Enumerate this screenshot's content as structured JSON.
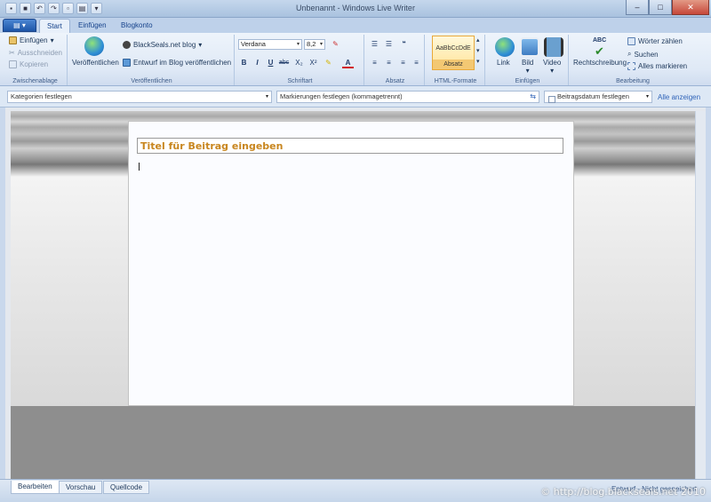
{
  "window": {
    "title": "Unbenannt - Windows Live Writer"
  },
  "tabs": [
    {
      "label": "Start"
    },
    {
      "label": "Einfügen"
    },
    {
      "label": "Blogkonto"
    }
  ],
  "ribbon": {
    "clipboard": {
      "paste": "Einfügen",
      "cut": "Ausschneiden",
      "copy": "Kopieren",
      "label": "Zwischenablage"
    },
    "publish": {
      "publish": "Veröffentlichen",
      "blog": "BlackSeals.net blog",
      "draft": "Entwurf im Blog veröffentlichen",
      "label": "Veröffentlichen"
    },
    "font": {
      "family": "Verdana",
      "size": "8,2",
      "bold": "B",
      "italic": "I",
      "underline": "U",
      "strike": "abc",
      "subscript": "X₂",
      "superscript": "X²",
      "color": "A",
      "label": "Schriftart"
    },
    "paragraph": {
      "label": "Absatz"
    },
    "html_formats": {
      "sample": "AaBbCcDdE",
      "style": "Absatz",
      "label": "HTML-Formate"
    },
    "insert": {
      "link": "Link",
      "image": "Bild",
      "video": "Video",
      "label": "Einfügen"
    },
    "edit": {
      "spellcheck_glyph": "ABC",
      "spellcheck": "Rechtschreibung",
      "wordcount": "Wörter zählen",
      "search": "Suchen",
      "select_all": "Alles markieren",
      "label": "Bearbeitung"
    }
  },
  "properties": {
    "categories": "Kategorien festlegen",
    "tags": "Markierungen festlegen (kommagetrennt)",
    "date": "Beitragsdatum festlegen",
    "show_all": "Alle anzeigen"
  },
  "editor": {
    "title_placeholder": "Titel für Beitrag eingeben"
  },
  "view_tabs": [
    {
      "label": "Bearbeiten"
    },
    {
      "label": "Vorschau"
    },
    {
      "label": "Quellcode"
    }
  ],
  "status": {
    "text": "Entwurf - Nicht gespeichert",
    "watermark": "© http://blog.blackseals.net 2010"
  }
}
